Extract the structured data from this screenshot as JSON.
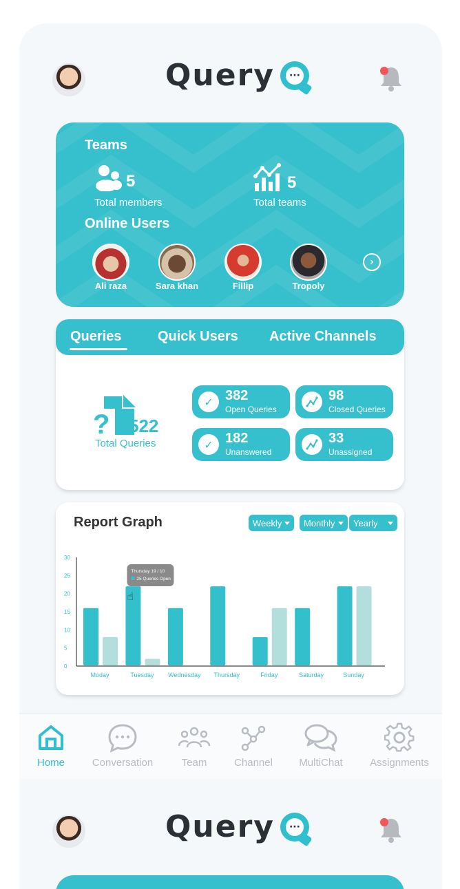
{
  "header": {
    "logo_text": "Query",
    "logo_icon": "chat-bubble-dots",
    "notification_icon": "bell"
  },
  "teams_card": {
    "title": "Teams",
    "members": {
      "value": "5",
      "label": "Total members",
      "icon": "users-icon"
    },
    "teams": {
      "value": "5",
      "label": "Total teams",
      "icon": "chart-growth-icon"
    },
    "online_title": "Online Users",
    "online_users": [
      {
        "name": "Ali raza"
      },
      {
        "name": "Sara khan"
      },
      {
        "name": "Fillip"
      },
      {
        "name": "Tropoly"
      }
    ]
  },
  "queries_card": {
    "tabs": [
      {
        "label": "Queries",
        "active": true
      },
      {
        "label": "Quick Users",
        "active": false
      },
      {
        "label": "Active Channels",
        "active": false
      }
    ],
    "total": {
      "value": "522",
      "label": "Total Queries"
    },
    "stats": [
      {
        "value": "382",
        "label": "Open Queries",
        "icon": "check-icon"
      },
      {
        "value": "98",
        "label": "Closed Queries",
        "icon": "trend-icon"
      },
      {
        "value": "182",
        "label": "Unanswered",
        "icon": "check-icon"
      },
      {
        "value": "33",
        "label": "Unassigned",
        "icon": "trend-icon"
      }
    ]
  },
  "graph_card": {
    "title": "Report Graph",
    "filters": [
      "Weekly",
      "Monthly",
      "Yearly"
    ],
    "tooltip": {
      "title": "Thursday 19 / 10",
      "text": "25 Queries Open"
    }
  },
  "chart_data": {
    "type": "bar",
    "categories": [
      "Moday",
      "Tuesday",
      "Wednesday",
      "Thursday",
      "Friday",
      "Saturday",
      "Sunday"
    ],
    "series": [
      {
        "values": [
          16,
          22,
          16,
          22,
          8,
          16,
          22
        ]
      },
      {
        "values": [
          8,
          2,
          null,
          null,
          16,
          null,
          22
        ]
      }
    ],
    "y_ticks": [
      0,
      5,
      10,
      15,
      20,
      25,
      30
    ],
    "ylim": [
      0,
      30
    ],
    "colors": [
      "#33bfcc",
      "#b2dfdb"
    ]
  },
  "nav": {
    "items": [
      {
        "label": "Home",
        "icon": "home-icon",
        "active": true
      },
      {
        "label": "Conversation",
        "icon": "chat-icon",
        "active": false
      },
      {
        "label": "Team",
        "icon": "team-icon",
        "active": false
      },
      {
        "label": "Channel",
        "icon": "channel-icon",
        "active": false
      },
      {
        "label": "MultiChat",
        "icon": "multichat-icon",
        "active": false
      },
      {
        "label": "Assignments",
        "icon": "gear-icon",
        "active": false
      }
    ]
  },
  "colors": {
    "accent": "#36bfcc",
    "accent_light": "#b2dfdb",
    "text_dark": "#2b2f36",
    "notification_dot": "#f0565a"
  }
}
